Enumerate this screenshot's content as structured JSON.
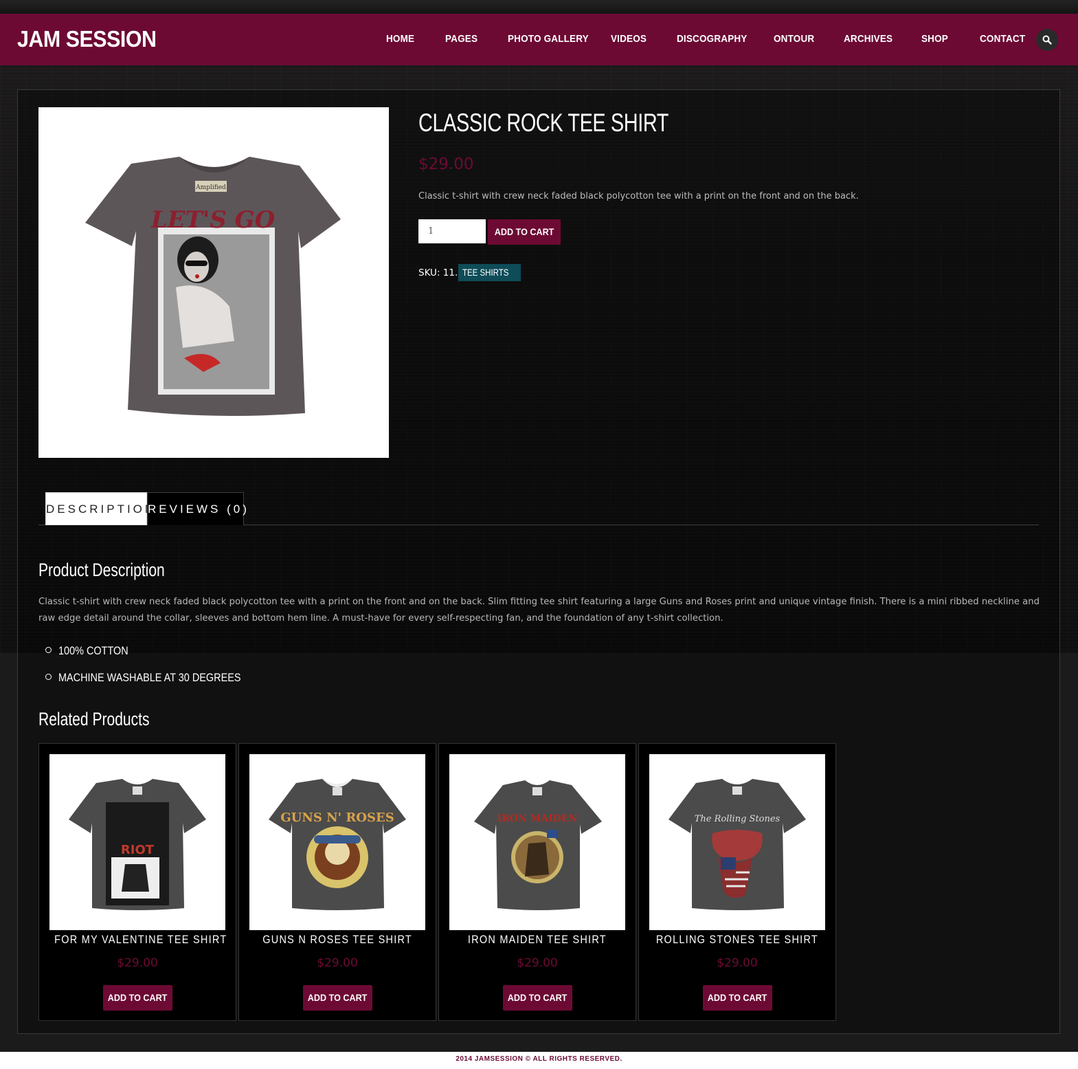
{
  "header": {
    "logo": "JAM SESSION",
    "nav": [
      "HOME",
      "PAGES",
      "PHOTO GALLERY",
      "VIDEOS",
      "DISCOGRAPHY",
      "ONTOUR",
      "ARCHIVES",
      "SHOP",
      "CONTACT"
    ],
    "search_icon": "search-icon"
  },
  "product": {
    "title": "CLASSIC ROCK TEE SHIRT",
    "price": "$29.00",
    "short_description": "Classic t-shirt with crew neck faded black polycotton tee with a print on the front and on the back.",
    "quantity": "1",
    "add_to_cart": "ADD TO CART",
    "sku_label": "SKU: 11.",
    "category": "TEE SHIRTS",
    "image_print_text": "LET'S GO",
    "image_tag_text": "Amplified"
  },
  "tabs": {
    "description": "DESCRIPTION",
    "reviews": "REVIEWS (0)"
  },
  "description": {
    "heading": "Product Description",
    "body": "Classic t-shirt with crew neck faded black polycotton tee with a print on the front and on the back. Slim fitting tee shirt featuring a large Guns and Roses print and unique vintage finish. There is a mini ribbed neckline and raw edge detail around the collar, sleeves and bottom hem line. A must-have for every self-respecting fan, and the foundation of any t-shirt collection.",
    "features": [
      "100% COTTON",
      "MACHINE WASHABLE AT 30 DEGREES"
    ]
  },
  "related": {
    "heading": "Related Products",
    "products": [
      {
        "name": "FOR MY VALENTINE TEE SHIRT",
        "price": "$29.00",
        "button": "ADD TO CART",
        "print_text": "RIOT"
      },
      {
        "name": "GUNS N ROSES TEE SHIRT",
        "price": "$29.00",
        "button": "ADD TO CART",
        "print_text": "GUNS N' ROSES"
      },
      {
        "name": "IRON MAIDEN TEE SHIRT",
        "price": "$29.00",
        "button": "ADD TO CART",
        "print_text": "IRON MAIDEN"
      },
      {
        "name": "ROLLING STONES TEE SHIRT",
        "price": "$29.00",
        "button": "ADD TO CART",
        "print_text": "The Rolling Stones"
      }
    ]
  },
  "footer": {
    "copyright": "2014 JAMSESSION © ALL RIGHTS RESERVED."
  },
  "colors": {
    "brand": "#6d0a34",
    "category_tag": "#0e4c58",
    "background": "#070707"
  }
}
